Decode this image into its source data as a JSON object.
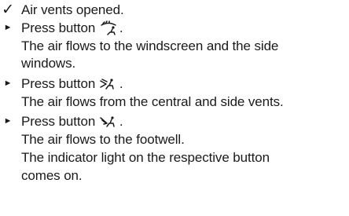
{
  "instructions": {
    "precondition": "Air vents opened.",
    "steps": [
      {
        "action_prefix": "Press button",
        "icon": "airflow-windscreen-icon",
        "action_suffix": ".",
        "result_lines": [
          "The air flows to the windscreen and the side",
          "windows."
        ]
      },
      {
        "action_prefix": "Press button",
        "icon": "airflow-central-vents-icon",
        "action_suffix": ".",
        "result_lines": [
          "The air flows from the central and side vents."
        ]
      },
      {
        "action_prefix": "Press button",
        "icon": "airflow-footwell-icon",
        "action_suffix": ".",
        "result_lines": [
          "The air flows to the footwell.",
          "The indicator light on the respective button",
          "comes on."
        ]
      }
    ]
  }
}
